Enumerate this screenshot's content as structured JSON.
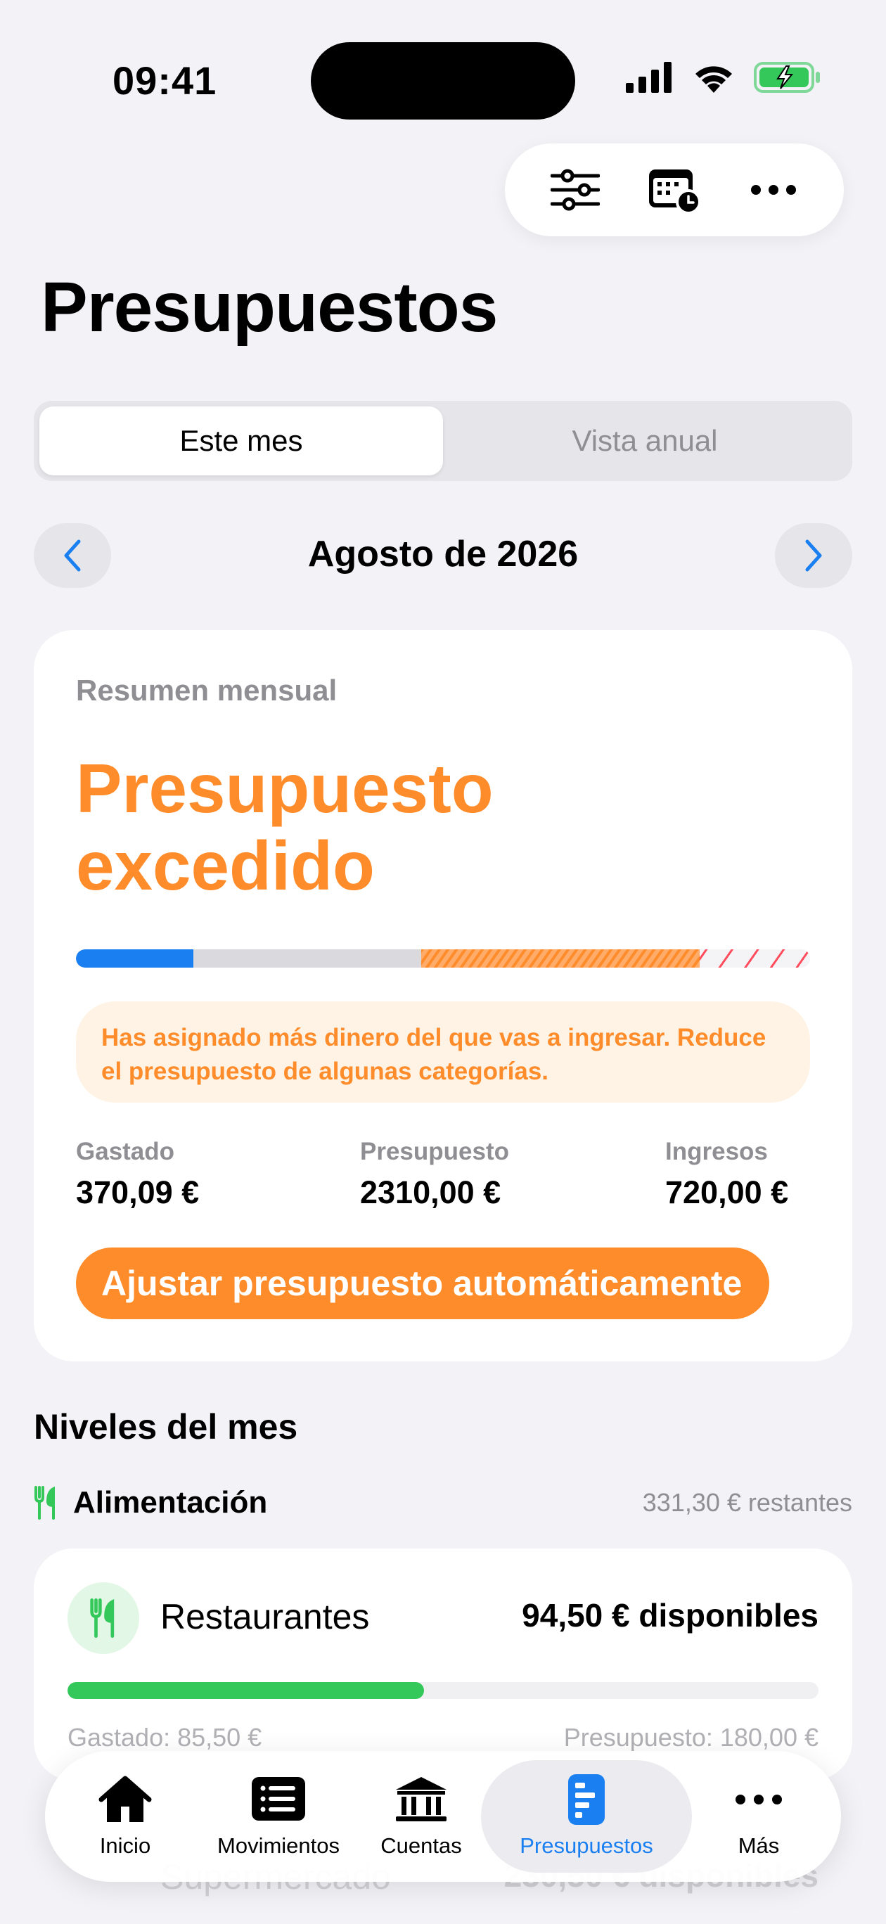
{
  "status_bar": {
    "time": "09:41",
    "icons": [
      "signal-icon",
      "wifi-icon",
      "battery-charging-icon"
    ]
  },
  "toolbar": {
    "icons": [
      "filter-sliders-icon",
      "calendar-clock-icon",
      "more-icon"
    ]
  },
  "page_title": "Presupuestos",
  "segmented": {
    "options": [
      "Este mes",
      "Vista anual"
    ],
    "selected": "Este mes"
  },
  "month_nav": {
    "label": "Agosto de 2026"
  },
  "summary": {
    "subtitle": "Resumen mensual",
    "headline": "Presupuesto excedido",
    "progress": {
      "spent_fraction": 0.16,
      "budget_fraction": 0.31,
      "overbudget_fraction": 0.38,
      "colors": {
        "spent": "#1a7ff0",
        "budget": "#d9d9de",
        "over": "#ffac6a",
        "excess": "#ff4d5e"
      }
    },
    "warning": "Has asignado más dinero del que vas a ingresar. Reduce el presupuesto de algunas categorías.",
    "stats": [
      {
        "label": "Gastado",
        "value": "370,09 €"
      },
      {
        "label": "Presupuesto",
        "value": "2310,00 €"
      },
      {
        "label": "Ingresos",
        "value": "720,00 €"
      }
    ],
    "adjust_button": "Ajustar presupuesto automáticamente"
  },
  "levels": {
    "title": "Niveles del mes",
    "category": {
      "name": "Alimentación",
      "remaining": "331,30 € restantes",
      "icon": "fork-knife-icon"
    },
    "items": [
      {
        "name": "Restaurantes",
        "available": "94,50 € disponibles",
        "spent": "Gastado: 85,50 €",
        "budget": "Presupuesto: 180,00 €",
        "progress": 0.475,
        "icon": "fork-knife-icon"
      }
    ],
    "partial_item": {
      "name": "Supermercado",
      "available": "230,50 € disponibles"
    }
  },
  "tabbar": {
    "tabs": [
      {
        "label": "Inicio",
        "icon": "house-icon"
      },
      {
        "label": "Movimientos",
        "icon": "list-icon"
      },
      {
        "label": "Cuentas",
        "icon": "bank-icon"
      },
      {
        "label": "Presupuestos",
        "icon": "budget-chart-icon"
      },
      {
        "label": "Más",
        "icon": "more-icon"
      }
    ],
    "active": "Presupuestos",
    "accent": "#1a7ff0"
  },
  "colors": {
    "accent_orange": "#ff8c2a",
    "accent_blue": "#1a7ff0",
    "accent_green": "#34c759"
  }
}
